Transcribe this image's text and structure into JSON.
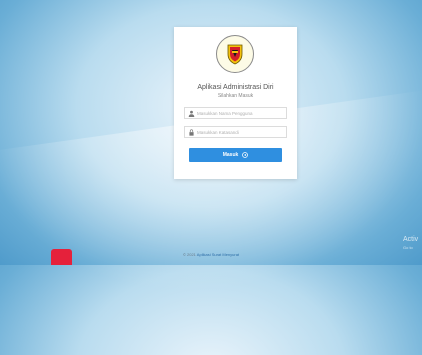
{
  "login": {
    "title": "Aplikasi Administrasi Diri",
    "subtitle": "Silahkan Masuk",
    "username_placeholder": "Masukkan Nama Pengguna",
    "password_placeholder": "Masukkan Katasandi",
    "submit_label": "Masuk"
  },
  "footer": {
    "copyright": "© 2021",
    "link_text": "Aplikasi Surat Menyurat"
  },
  "watermark": {
    "line1": "Activ",
    "line2": "Go to"
  },
  "colors": {
    "primary_button": "#2f8fe0",
    "background": "#6aaed6",
    "red_square": "#e5213b"
  },
  "icons": {
    "user": "user-icon",
    "lock": "lock-icon",
    "submit": "arrow-circle-right-icon",
    "logo": "shield-emblem-icon"
  }
}
